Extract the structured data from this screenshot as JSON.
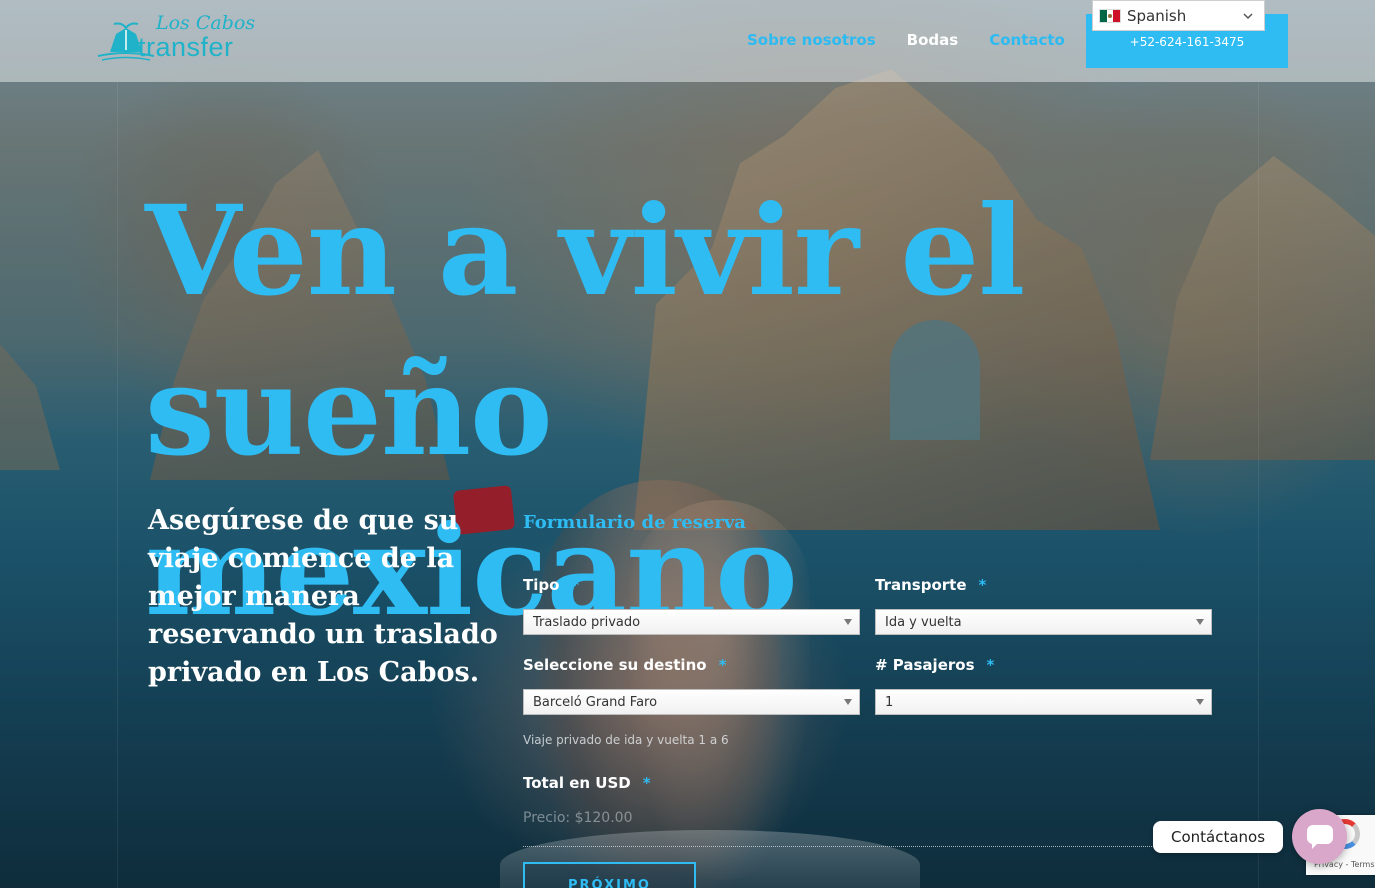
{
  "header": {
    "logo_script": "Los Cabos",
    "logo_word": "transfer",
    "nav": [
      {
        "label": "Sobre nosotros"
      },
      {
        "label": "Bodas"
      },
      {
        "label": "Contacto"
      }
    ],
    "phone": "+52-624-161-3475",
    "language": {
      "label": "Spanish",
      "flag": "mexico-flag-icon"
    }
  },
  "hero": {
    "title_line1": "Ven a vivir el",
    "title_line2": "sueño mexicano",
    "subtitle": "Asegúrese de que su viaje comience de la mejor manera reservando un traslado privado en Los Cabos."
  },
  "form": {
    "title": "Formulario de reserva",
    "required_mark": "*",
    "fields": {
      "tipo": {
        "label": "Tipo",
        "value": "Traslado privado"
      },
      "transporte": {
        "label": "Transporte",
        "value": "Ida y vuelta"
      },
      "destino": {
        "label": "Seleccione su destino",
        "value": "Barceló Grand Faro"
      },
      "pasajeros": {
        "label": "# Pasajeros",
        "value": "1"
      }
    },
    "description": "Viaje privado de ida y vuelta 1 a 6",
    "total_label": "Total en USD",
    "price": "Precio: $120.00",
    "submit_label": "PRÓXIMO"
  },
  "widgets": {
    "contact_label": "Contáctanos",
    "recaptcha_links": "Privacy - Terms"
  },
  "colors": {
    "accent": "#2fbcf3",
    "header_bg": "#e1e6e8",
    "white": "#ffffff"
  }
}
